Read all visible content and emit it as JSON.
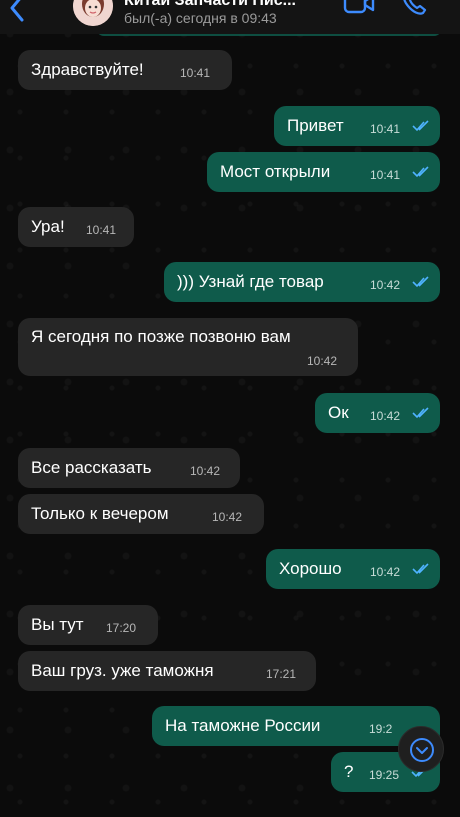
{
  "header": {
    "title": "Китай Запчасти Пис...",
    "status": "был(-а) сегодня в 09:43",
    "icons": [
      "back-arrow-icon",
      "avatar",
      "video-call-icon",
      "phone-call-icon"
    ]
  },
  "colors": {
    "background": "#0b0b0b",
    "incoming_bubble": "#262626",
    "outgoing_bubble": "#0f5b4b",
    "read_ticks": "#4fb3ff"
  },
  "messages": [
    {
      "dir": "in",
      "text": "Здравствуйте!",
      "time": "10:41"
    },
    {
      "dir": "out",
      "text": "Привет",
      "time": "10:41",
      "read": true
    },
    {
      "dir": "out",
      "text": "Мост открыли",
      "time": "10:41",
      "read": true
    },
    {
      "dir": "in",
      "text": "Ура!",
      "time": "10:41"
    },
    {
      "dir": "out",
      "text": "))) Узнай где товар",
      "time": "10:42",
      "read": true
    },
    {
      "dir": "in",
      "text": "Я сегодня по позже позвоню вам",
      "time": "10:42"
    },
    {
      "dir": "out",
      "text": "Ок",
      "time": "10:42",
      "read": true
    },
    {
      "dir": "in",
      "text": "Все рассказать",
      "time": "10:42"
    },
    {
      "dir": "in",
      "text": "Только к вечером",
      "time": "10:42"
    },
    {
      "dir": "out",
      "text": "Хорошо",
      "time": "10:42",
      "read": true
    },
    {
      "dir": "in",
      "text": "Вы тут",
      "time": "17:20"
    },
    {
      "dir": "in",
      "text": "Ваш груз. уже таможня",
      "time": "17:21"
    },
    {
      "dir": "out",
      "text": "На таможне России",
      "time": "19:2",
      "read": false
    },
    {
      "dir": "out",
      "text": "?",
      "time": "19:25",
      "read": true
    }
  ],
  "scroll_button": {
    "icon": "chevron-down-icon"
  }
}
